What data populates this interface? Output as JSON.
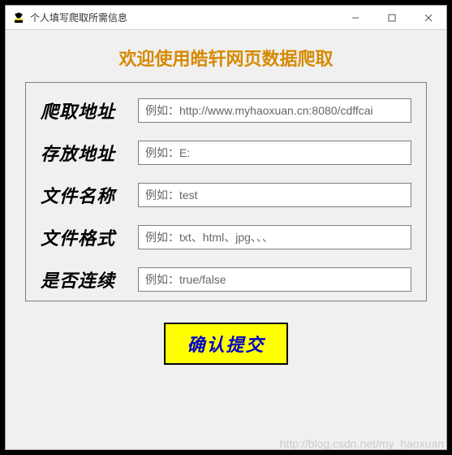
{
  "window": {
    "title": "个人填写爬取所需信息"
  },
  "heading": "欢迎使用皓轩网页数据爬取",
  "form": {
    "rows": [
      {
        "label": "爬取地址",
        "placeholder": "例如：http://www.myhaoxuan.cn:8080/cdffcai",
        "value": ""
      },
      {
        "label": "存放地址",
        "placeholder": "例如：E:",
        "value": ""
      },
      {
        "label": "文件名称",
        "placeholder": "例如：test",
        "value": ""
      },
      {
        "label": "文件格式",
        "placeholder": "例如：txt、html、jpg、、、",
        "value": ""
      },
      {
        "label": "是否连续",
        "placeholder": "例如：true/false",
        "value": ""
      }
    ]
  },
  "submit_label": "确认提交",
  "watermark": "http://blog.csdn.net/my_haoxuan"
}
